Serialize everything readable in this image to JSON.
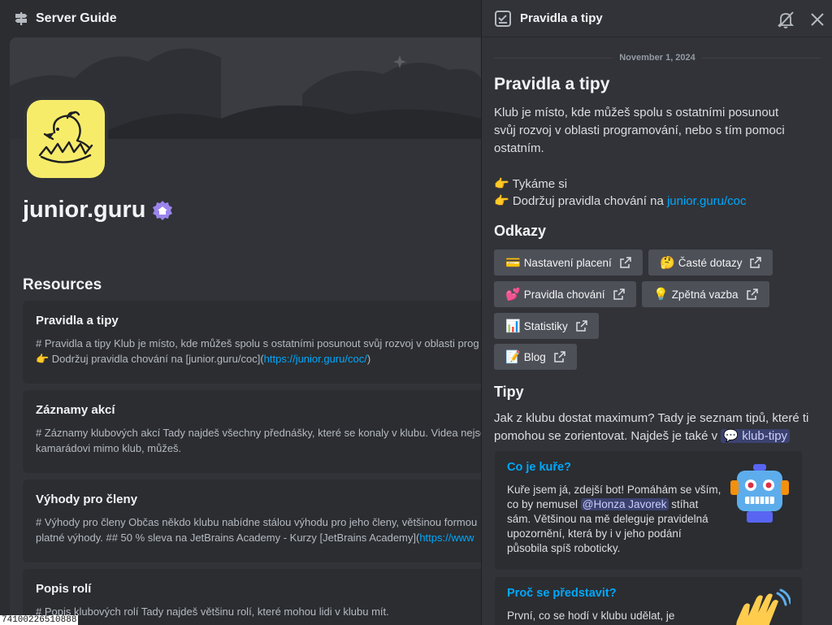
{
  "left": {
    "header_title": "Server Guide",
    "guild_name": "junior.guru",
    "resources_heading": "Resources",
    "resources": [
      {
        "title": "Pravidla a tipy",
        "line1": "# Pravidla a tipy Klub je místo, kde můžeš spolu s ostatními posunout svůj rozvoj v oblasti prog",
        "line2_pre": "👉 Dodržuj pravidla chování na [junior.guru/coc](",
        "line2_link": "https://junior.guru/coc/",
        "line2_post": ")"
      },
      {
        "title": "Záznamy akcí",
        "line1": "# Záznamy klubových akcí Tady najdeš všechny přednášky, které se konaly v klubu. Videa nejso",
        "line2_pre": "kamarádovi mimo klub, můžeš.",
        "line2_link": "",
        "line2_post": ""
      },
      {
        "title": "Výhody pro členy",
        "line1": "# Výhody pro členy Občas někdo klubu nabídne stálou výhodu pro jeho členy, většinou formou",
        "line2_pre": "platné výhody. ## 50 % sleva na JetBrains Academy - Kurzy [JetBrains Academy](",
        "line2_link": "https://www",
        "line2_post": ""
      },
      {
        "title": "Popis rolí",
        "line1": "# Popis klubových rolí Tady najdeš většinu rolí, které mohou lidi v klubu mít.",
        "line2_pre": "",
        "line2_link": "",
        "line2_post": ""
      }
    ],
    "tooltip_id": "74100226510888"
  },
  "right": {
    "channel_title": "Pravidla a tipy",
    "date": "November 1, 2024",
    "heading": "Pravidla a tipy",
    "intro": "Klub je místo, kde můžeš spolu s ostatními posunout svůj rozvoj v oblasti programování, nebo s tím pomoci ostatním.",
    "bullet1": "👉 Tykáme si",
    "bullet2_pre": "👉 Dodržuj pravidla chování na ",
    "bullet2_link": "junior.guru/coc",
    "links_heading": "Odkazy",
    "buttons": [
      {
        "emoji": "💳",
        "label": "Nastavení placení"
      },
      {
        "emoji": "🤔",
        "label": "Časté dotazy"
      },
      {
        "emoji": "💕",
        "label": "Pravidla chování"
      },
      {
        "emoji": "💡",
        "label": "Zpětná vazba"
      },
      {
        "emoji": "📊",
        "label": "Statistiky"
      },
      {
        "emoji": "📝",
        "label": "Blog"
      }
    ],
    "tips_heading": "Tipy",
    "tips_intro": "Jak z klubu dostat maximum? Tady je seznam tipů, které ti pomohou se zorientovat. Najdeš je také v ",
    "tips_channel": "klub-tipy",
    "embeds": [
      {
        "title": "Co je kuře?",
        "body_pre": "Kuře jsem já, zdejší bot! Pomáhám se vším, co by nemusel ",
        "mention": "@Honza Javorek",
        "body_post": " stíhat sám. Většinou na mě deleguje pravidelná upozornění, která by i v jeho podání působila spíš roboticky.",
        "thumb_icon": "robot-icon"
      },
      {
        "title": "Proč se představit?",
        "body_pre": "První, co se hodí v klubu udělat, je představit",
        "mention": "",
        "body_post": "",
        "thumb_icon": "waving-hand-icon"
      }
    ]
  },
  "colors": {
    "accent_link": "#00a8fc",
    "avatar_yellow": "#f7ec6a",
    "button_bg": "#4e5058"
  }
}
